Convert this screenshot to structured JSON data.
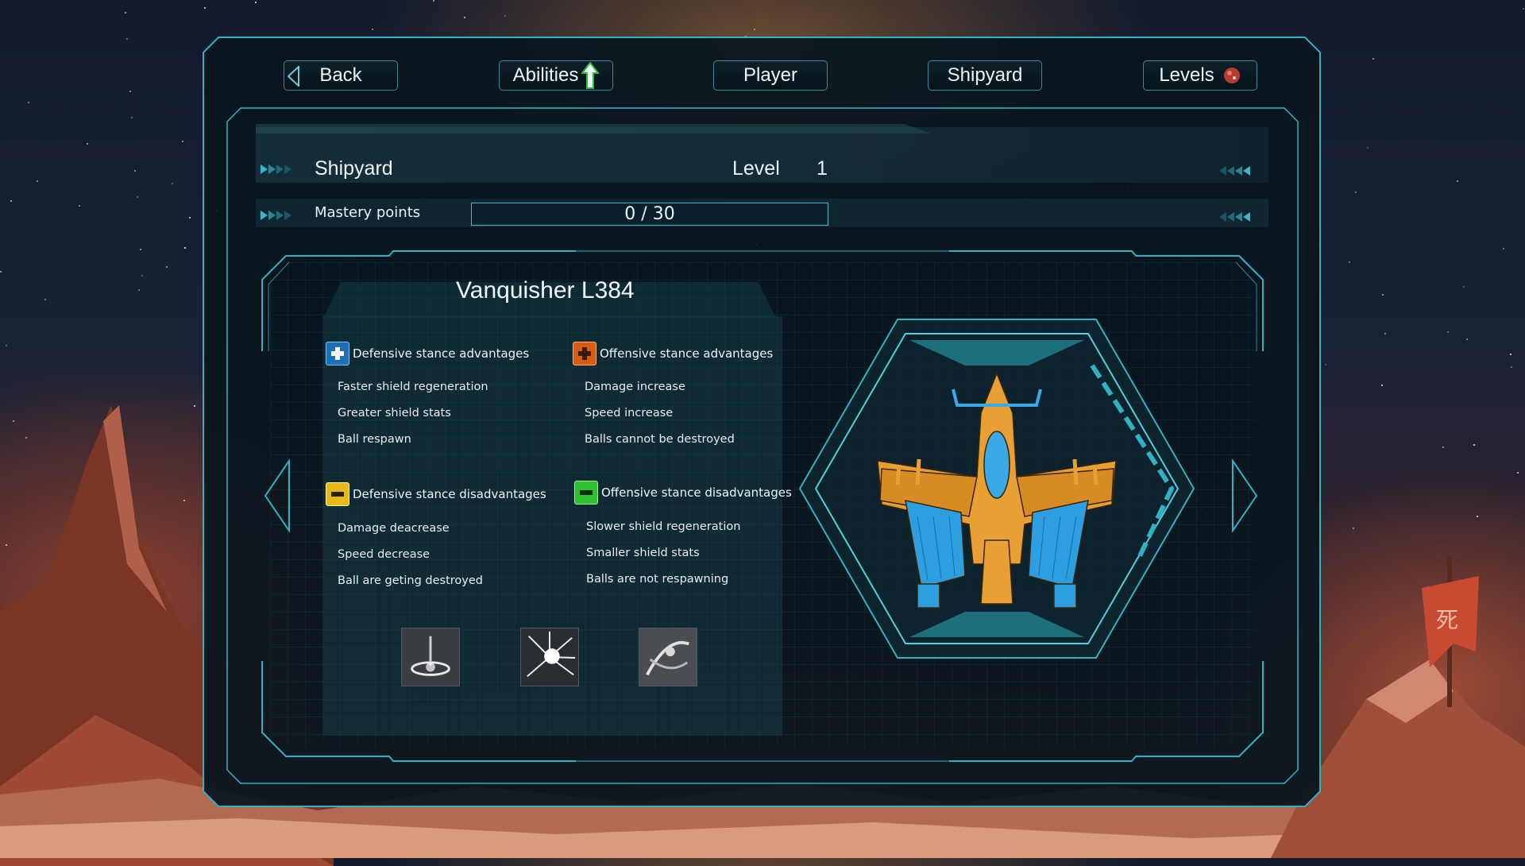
{
  "nav": {
    "back": "Back",
    "abilities": "Abilities",
    "player": "Player",
    "shipyard": "Shipyard",
    "levels": "Levels"
  },
  "header": {
    "title": "Shipyard",
    "level_label": "Level",
    "level_value": "1",
    "mastery_label": "Mastery points",
    "mastery_text": "0 / 30",
    "mastery_progress": 0
  },
  "ship": {
    "name": "Vanquisher L384"
  },
  "sections": {
    "def_adv": {
      "title": "Defensive stance advantages",
      "items": [
        "Faster shield regeneration",
        "Greater shield stats",
        "Ball respawn"
      ]
    },
    "off_adv": {
      "title": "Offensive stance advantages",
      "items": [
        "Damage increase",
        "Speed increase",
        "Balls cannot be destroyed"
      ]
    },
    "def_dis": {
      "title": "Defensive stance disadvantages",
      "items": [
        "Damage deacrease",
        "Speed decrease",
        "Ball are geting destroyed"
      ]
    },
    "off_dis": {
      "title": "Offensive stance disadvantages",
      "items": [
        "Slower shield regeneration",
        "Smaller shield stats",
        "Balls are not respawning"
      ]
    }
  },
  "colors": {
    "accent": "#2fb2c4",
    "panel": "#09161e",
    "def_adv_badge": "#2f8fd8",
    "off_adv_badge": "#e0701c",
    "def_dis_badge": "#e6b818",
    "off_dis_badge": "#3cc83c"
  },
  "icons": {
    "back": "left-triangle-icon",
    "abilities": "up-arrow-icon",
    "levels": "planet-icon"
  }
}
